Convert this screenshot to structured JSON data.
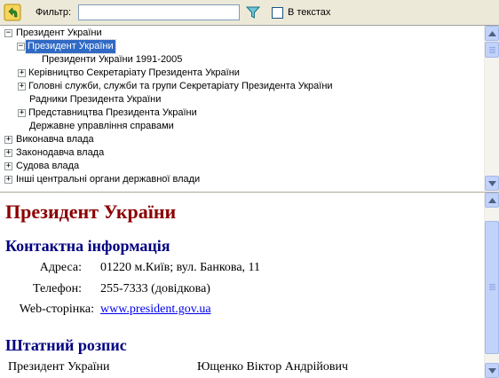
{
  "toolbar": {
    "back_icon": "back-arrow-icon",
    "filter_label": "Фильтр:",
    "filter_value": "",
    "filter_icon": "funnel-icon",
    "in_texts_label": "В текстах",
    "in_texts_checked": false
  },
  "tree": {
    "items": [
      {
        "label": "Президент України",
        "expander": "−",
        "expanded": true
      },
      {
        "label": "Президент України",
        "expander": "−",
        "expanded": true,
        "selected": true
      },
      {
        "label": "Президенти України 1991-2005",
        "expander": ""
      },
      {
        "label": "Керівництво Секретаріату Президента України",
        "expander": "+"
      },
      {
        "label": "Головні служби, служби та групи Секретаріату Президента України",
        "expander": "+"
      },
      {
        "label": "Радники Президента України",
        "expander": ""
      },
      {
        "label": "Представництва Президента України",
        "expander": "+"
      },
      {
        "label": "Державне управління справами",
        "expander": ""
      },
      {
        "label": "Виконавча влада",
        "expander": "+"
      },
      {
        "label": "Законодавча влада",
        "expander": "+"
      },
      {
        "label": "Судова влада",
        "expander": "+"
      },
      {
        "label": "Інші центральні органи державної влади",
        "expander": "+"
      }
    ]
  },
  "detail": {
    "title": "Президент України",
    "contact_heading": "Контактна інформація",
    "address_label": "Адреса:",
    "address_value": "01220 м.Київ; вул. Банкова, 11",
    "phone_label": "Телефон:",
    "phone_value": "255-7333 (довідкова)",
    "web_label": "Web-сторінка:",
    "web_value": "www.president.gov.ua",
    "staff_heading": "Штатний розпис",
    "staff": [
      {
        "position": "Президент України",
        "name": "Ющенко Віктор Андрійович"
      }
    ]
  },
  "colors": {
    "title": "#8b0000",
    "heading": "#000080",
    "link": "#0000ee",
    "selection": "#316ac5"
  }
}
